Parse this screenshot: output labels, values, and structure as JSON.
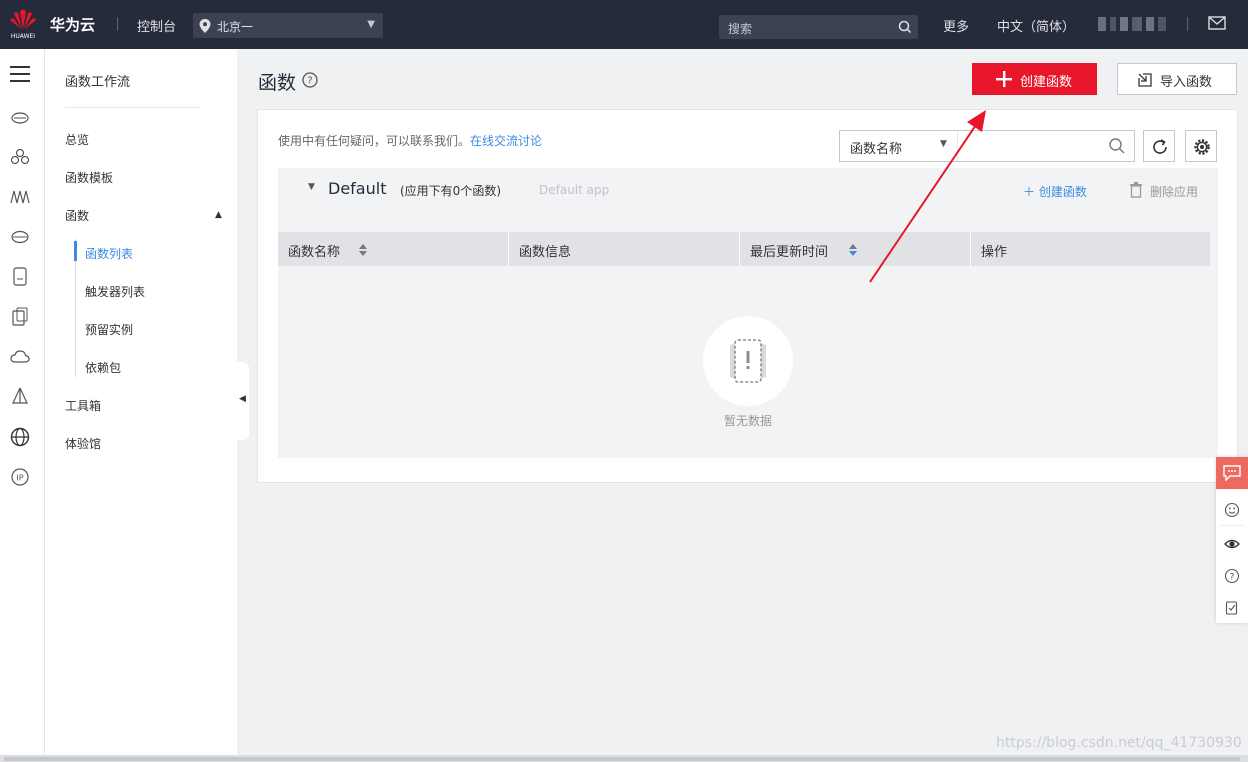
{
  "topbar": {
    "logo_text": "HUAWEI",
    "brand": "华为云",
    "console": "控制台",
    "region": "北京一",
    "search_placeholder": "搜索",
    "more": "更多",
    "language": "中文（简体）"
  },
  "subnav": {
    "title": "函数工作流",
    "items": [
      {
        "label": "总览"
      },
      {
        "label": "函数模板"
      },
      {
        "label": "函数"
      },
      {
        "label": "工具箱"
      },
      {
        "label": "体验馆"
      }
    ],
    "function_children": [
      {
        "label": "函数列表",
        "active": true
      },
      {
        "label": "触发器列表"
      },
      {
        "label": "预留实例"
      },
      {
        "label": "依赖包"
      }
    ]
  },
  "page": {
    "title": "函数",
    "create_button": "创建函数",
    "import_button": "导入函数"
  },
  "panel": {
    "tip_text": "使用中有任何疑问，可以联系我们。",
    "tip_link": "在线交流讨论",
    "filter_field": "函数名称",
    "group": {
      "name": "Default",
      "count_text": "(应用下有0个函数)",
      "app_placeholder": "Default app",
      "add_link": "创建函数",
      "delete_link": "删除应用"
    },
    "columns": [
      "函数名称",
      "函数信息",
      "最后更新时间",
      "操作"
    ],
    "empty_text": "暂无数据"
  },
  "watermark": "https://blog.csdn.net/qq_41730930",
  "colors": {
    "topbar": "#252b3a",
    "primary_red": "#e8162a",
    "link_blue": "#3b8be0",
    "annotation": "#e8162a"
  }
}
